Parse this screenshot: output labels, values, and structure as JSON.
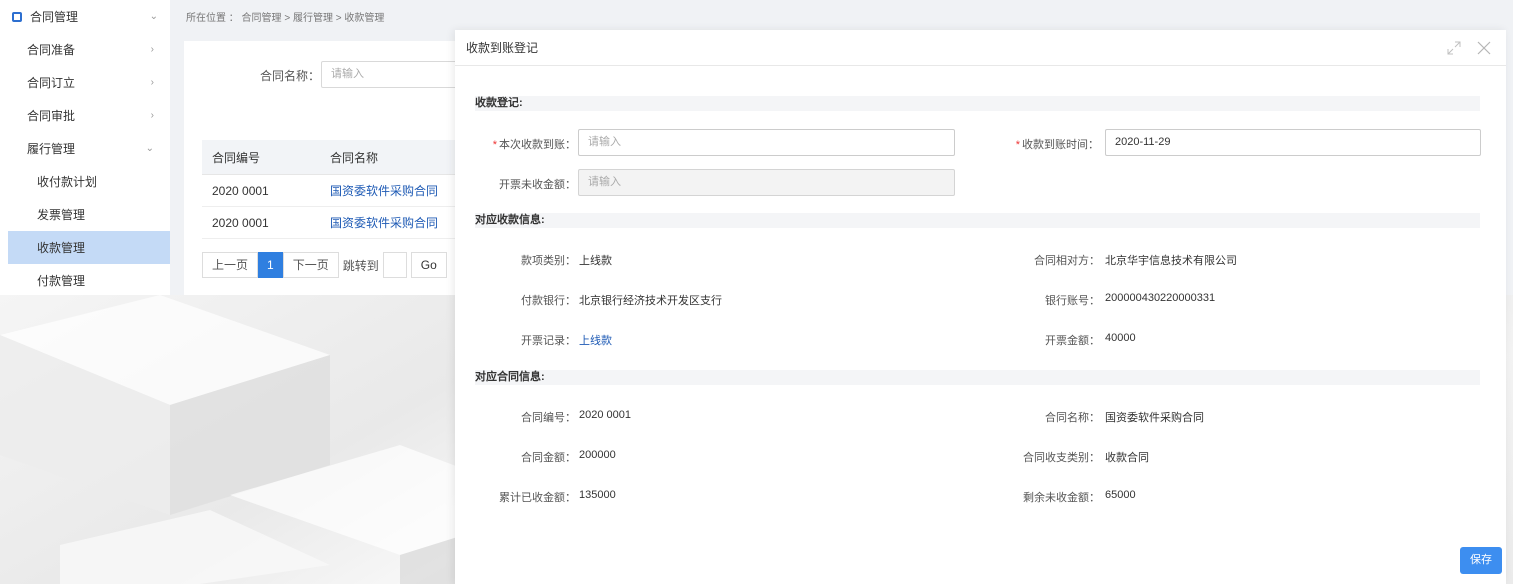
{
  "sidebar": {
    "top": {
      "label": "合同管理",
      "icon": "contract-icon"
    },
    "items": [
      {
        "label": "合同准备"
      },
      {
        "label": "合同订立"
      },
      {
        "label": "合同审批"
      },
      {
        "label": "履行管理"
      }
    ],
    "subs": [
      {
        "label": "收付款计划"
      },
      {
        "label": "发票管理"
      },
      {
        "label": "收款管理"
      },
      {
        "label": "付款管理"
      }
    ]
  },
  "breadcrumb": "所在位置 ： 合同管理 > 履行管理 > 收款管理",
  "list": {
    "filter_label": "合同名称：",
    "filter_placeholder": "请输入",
    "columns": [
      "合同编号",
      "合同名称"
    ],
    "rows": [
      [
        "2020 0001",
        "国资委软件采购合同"
      ],
      [
        "2020 0001",
        "国资委软件采购合同"
      ]
    ],
    "pager": {
      "prev": "上一页",
      "current": "1",
      "next": "下一页",
      "jump": "跳转到",
      "go": "Go"
    }
  },
  "drawer": {
    "title": "收款到账登记",
    "sections": {
      "reg": "收款登记:",
      "recv": "对应收款信息:",
      "contract": "对应合同信息:"
    },
    "form": {
      "amount_label": "本次收款到账：",
      "amount_placeholder": "请输入",
      "time_label": "收款到账时间：",
      "time_value": "2020-11-29",
      "uninvoiced_label": "开票未收金额：",
      "uninvoiced_placeholder": "请输入"
    },
    "recv_info": {
      "type_label": "款项类别：",
      "type_value": "上线款",
      "party_label": "合同相对方：",
      "party_value": "北京华宇信息技术有限公司",
      "bank_label": "付款银行：",
      "bank_value": "北京银行经济技术开发区支行",
      "account_label": "银行账号：",
      "account_value": "200000430220000331",
      "invoice_label": "开票记录：",
      "invoice_value": "上线款",
      "invoice_amount_label": "开票金额：",
      "invoice_amount_value": "40000"
    },
    "contract_info": {
      "no_label": "合同编号：",
      "no_value": "2020 0001",
      "name_label": "合同名称：",
      "name_value": "国资委软件采购合同",
      "amount_label": "合同金额：",
      "amount_value": "200000",
      "type_label": "合同收支类别：",
      "type_value": "收款合同",
      "received_label": "累计已收金额：",
      "received_value": "135000",
      "remaining_label": "剩余未收金额：",
      "remaining_value": "65000"
    },
    "save": "保存"
  },
  "colors": {
    "accent": "#3d8ef0",
    "link": "#1f5bb5",
    "active_bg": "#c4daf6",
    "required": "#e33333"
  }
}
